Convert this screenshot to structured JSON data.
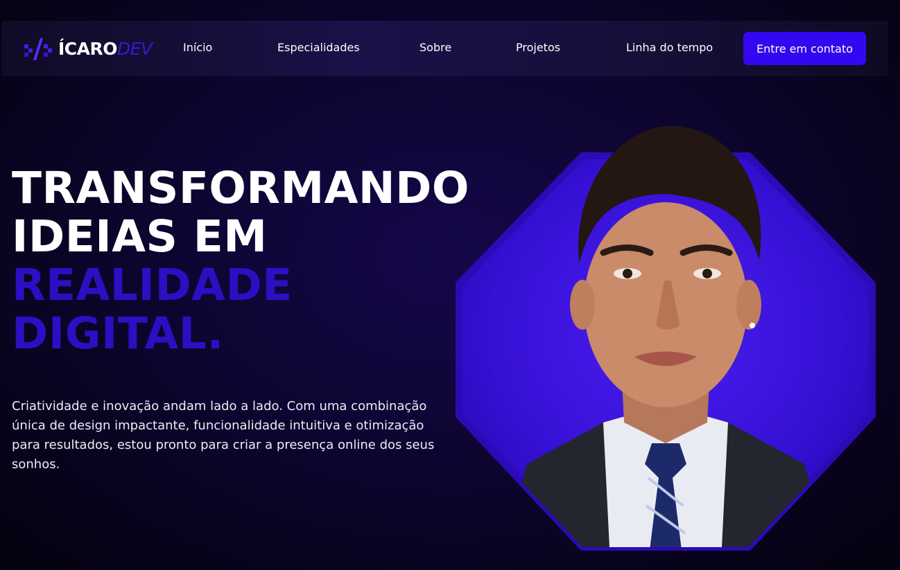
{
  "nav": {
    "logo": {
      "brand": "ÍCARO",
      "suffix": "DEV",
      "icon": "code-brackets-icon"
    },
    "links": [
      "Início",
      "Especialidades",
      "Sobre",
      "Projetos",
      "Linha do tempo"
    ],
    "cta_label": "Entre em contato"
  },
  "hero": {
    "headline_lines": [
      "TRANSFORMANDO",
      "IDEIAS EM"
    ],
    "headline_accent_lines": [
      "REALIDADE",
      "DIGITAL."
    ],
    "description": "Criatividade e inovação andam lado a lado. Com uma combinação única de design impactante, funcionalidade intuitiva e otimização para resultados, estou pronto para criar a presença online dos seus sonhos.",
    "portrait_icon": "profile-portrait-image"
  },
  "colors": {
    "accent": "#3307f0",
    "headline_accent": "#2a10c2",
    "octagon": "#3a0ecf",
    "background": "#0d0530"
  }
}
